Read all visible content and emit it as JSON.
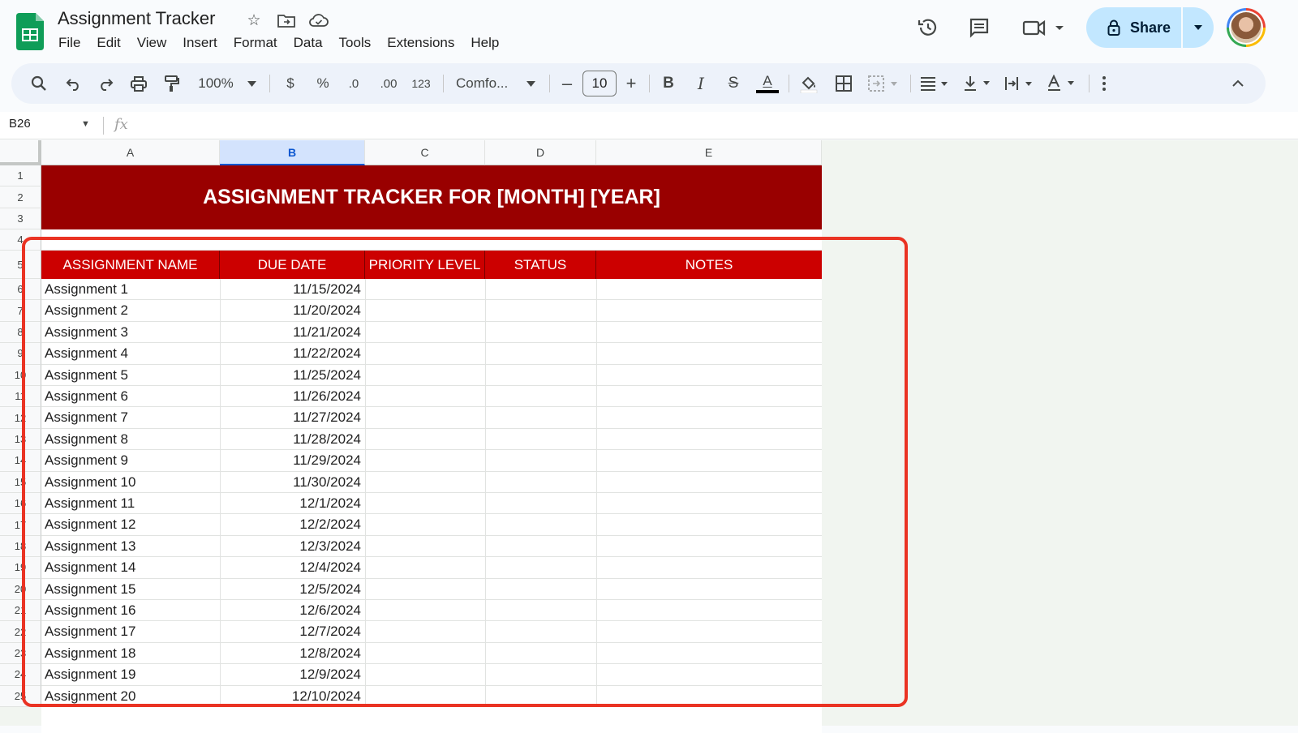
{
  "app": {
    "doc_title": "Assignment Tracker",
    "menu": [
      "File",
      "Edit",
      "View",
      "Insert",
      "Format",
      "Data",
      "Tools",
      "Extensions",
      "Help"
    ],
    "share_label": "Share"
  },
  "toolbar": {
    "zoom": "100%",
    "currency": "$",
    "percent": "%",
    "decrease_decimal": ".0",
    "increase_decimal": ".00",
    "number_format": "123",
    "font": "Comfo...",
    "font_size": "10",
    "minus": "–",
    "plus": "+",
    "bold": "B",
    "italic": "I",
    "strike": "S",
    "text_color": "A"
  },
  "formula_bar": {
    "name_box": "B26",
    "fx": "fx"
  },
  "columns": [
    "A",
    "B",
    "C",
    "D",
    "E"
  ],
  "rows": [
    "1",
    "2",
    "3",
    "4",
    "5",
    "6",
    "7",
    "8",
    "9",
    "10",
    "11",
    "12",
    "13",
    "14",
    "15",
    "16",
    "17",
    "18",
    "19",
    "20",
    "21",
    "22",
    "23",
    "24",
    "25"
  ],
  "sheet": {
    "title": "ASSIGNMENT TRACKER FOR [MONTH] [YEAR]",
    "headers": [
      "ASSIGNMENT NAME",
      "DUE DATE",
      "PRIORITY LEVEL",
      "STATUS",
      "NOTES"
    ],
    "records": [
      {
        "name": "Assignment 1",
        "due": "11/15/2024"
      },
      {
        "name": "Assignment 2",
        "due": "11/20/2024"
      },
      {
        "name": "Assignment 3",
        "due": "11/21/2024"
      },
      {
        "name": "Assignment 4",
        "due": "11/22/2024"
      },
      {
        "name": "Assignment 5",
        "due": "11/25/2024"
      },
      {
        "name": "Assignment 6",
        "due": "11/26/2024"
      },
      {
        "name": "Assignment 7",
        "due": "11/27/2024"
      },
      {
        "name": "Assignment 8",
        "due": "11/28/2024"
      },
      {
        "name": "Assignment 9",
        "due": "11/29/2024"
      },
      {
        "name": "Assignment 10",
        "due": "11/30/2024"
      },
      {
        "name": "Assignment 11",
        "due": "12/1/2024"
      },
      {
        "name": "Assignment 12",
        "due": "12/2/2024"
      },
      {
        "name": "Assignment 13",
        "due": "12/3/2024"
      },
      {
        "name": "Assignment 14",
        "due": "12/4/2024"
      },
      {
        "name": "Assignment 15",
        "due": "12/5/2024"
      },
      {
        "name": "Assignment 16",
        "due": "12/6/2024"
      },
      {
        "name": "Assignment 17",
        "due": "12/7/2024"
      },
      {
        "name": "Assignment 18",
        "due": "12/8/2024"
      },
      {
        "name": "Assignment 19",
        "due": "12/9/2024"
      },
      {
        "name": "Assignment 20",
        "due": "12/10/2024"
      }
    ]
  },
  "colors": {
    "title_band": "#990000",
    "header_row": "#cc0000",
    "highlight": "#ea3323",
    "share_button": "#c2e7ff"
  }
}
